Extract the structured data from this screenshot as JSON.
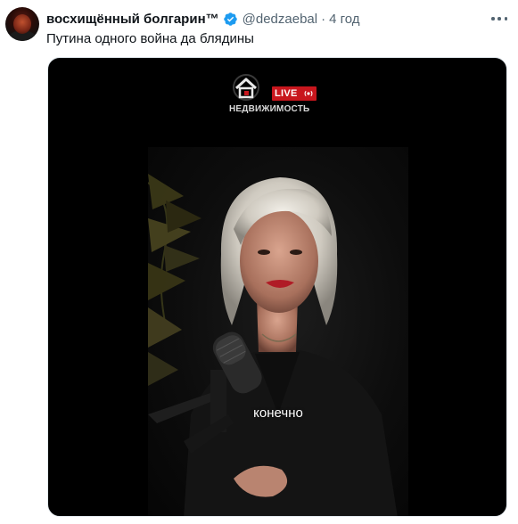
{
  "tweet": {
    "author_name": "восхищённый болгарин™",
    "handle": "@dedzaebal",
    "separator": "·",
    "time": "4 год",
    "text": "Путина одного война да блядины",
    "verified": true
  },
  "video": {
    "live_label": "LIVE",
    "brand": "НЕДВИЖИМОСТЬ",
    "caption": "конечно"
  },
  "icons": {
    "verified": "verified-badge-icon",
    "more": "more-options-icon",
    "live": "broadcast-icon",
    "logo": "house-logo-icon"
  },
  "colors": {
    "text_primary": "#0f1419",
    "text_secondary": "#536471",
    "verified_blue": "#1d9bf0",
    "live_red": "#c8161d",
    "media_background": "#000000"
  }
}
